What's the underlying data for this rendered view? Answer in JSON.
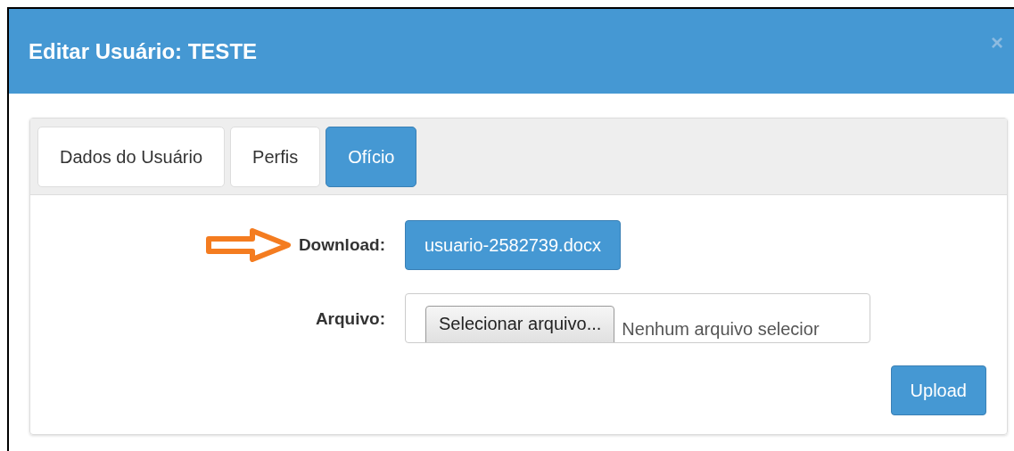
{
  "modal": {
    "title": "Editar Usuário: TESTE",
    "close": "×"
  },
  "tabs": [
    {
      "label": "Dados do Usuário",
      "selected": false
    },
    {
      "label": "Perfis",
      "selected": false
    },
    {
      "label": "Ofício",
      "selected": true
    }
  ],
  "download": {
    "label": "Download:",
    "file": "usuario-2582739.docx"
  },
  "arquivo": {
    "label": "Arquivo:",
    "button": "Selecionar arquivo...",
    "status": "Nenhum arquivo selecior"
  },
  "upload": "Upload"
}
